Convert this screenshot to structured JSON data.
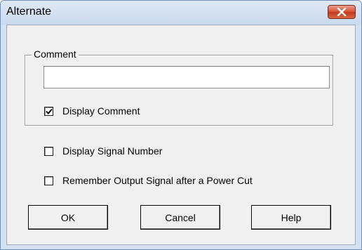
{
  "window": {
    "title": "Alternate"
  },
  "comment_group": {
    "legend": "Comment",
    "input": {
      "value": "",
      "placeholder": ""
    },
    "display_comment": {
      "label": "Display Comment",
      "checked": true
    }
  },
  "options": {
    "display_signal_number": {
      "label": "Display Signal Number",
      "checked": false
    },
    "remember_output_signal": {
      "label": "Remember Output Signal after a Power Cut",
      "checked": false
    }
  },
  "buttons": {
    "ok": "OK",
    "cancel": "Cancel",
    "help": "Help"
  },
  "icons": {
    "close": "close-icon",
    "check": "checkmark-icon"
  },
  "colors": {
    "titlebar": "#d3e1f1",
    "close_button": "#c94a2d",
    "client_background": "#f0f0f0"
  }
}
